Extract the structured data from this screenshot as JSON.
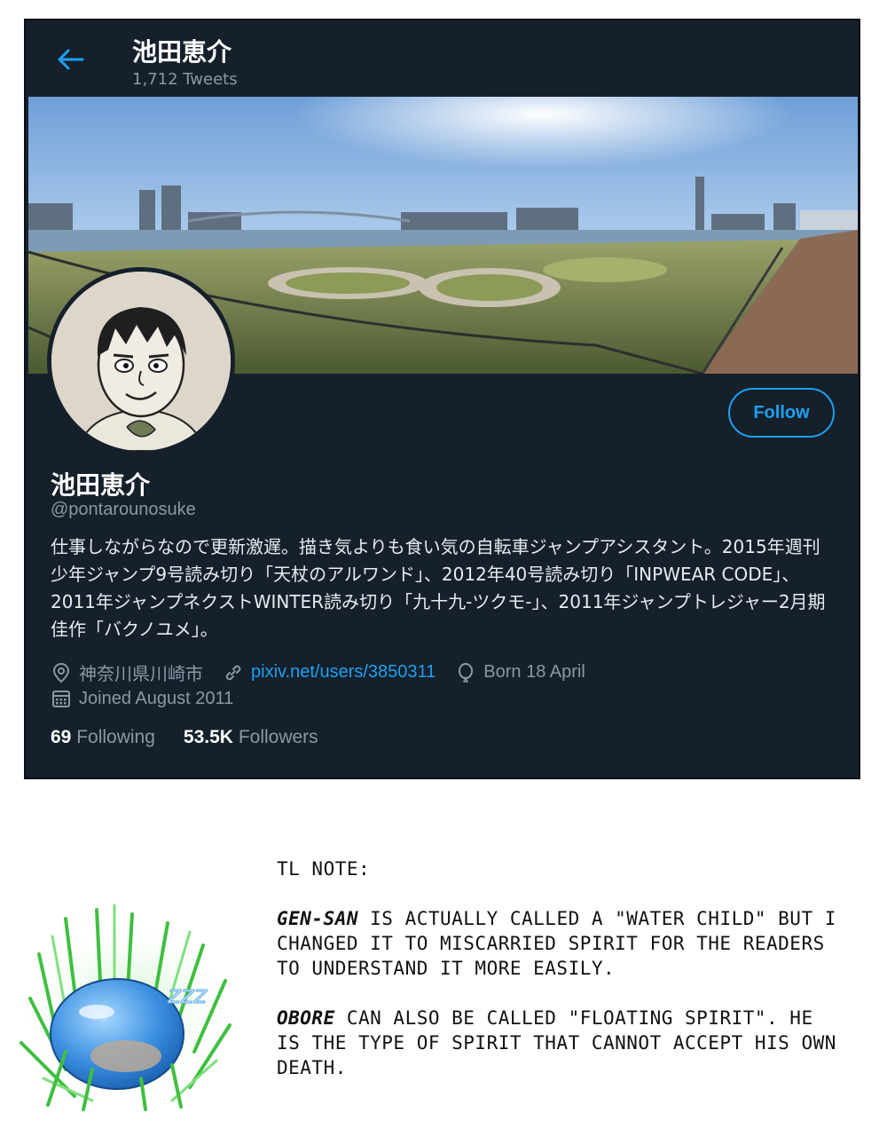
{
  "profile": {
    "header_name": "池田恵介",
    "tweet_count": "1,712 Tweets",
    "display_name": "池田恵介",
    "handle": "@pontarounosuke",
    "bio": "仕事しながらなので更新激遅。描き気よりも食い気の自転車ジャンプアシスタント。2015年週刊少年ジャンプ9号読み切り「天杖のアルワンド」、2012年40号読み切り「INPWEAR CODE」、2011年ジャンプネクストWINTER読み切り「九十九-ツクモ-」、2011年ジャンプトレジャー2月期 佳作「バクノユメ」。",
    "location": "神奈川県川崎市",
    "website": "pixiv.net/users/3850311",
    "birthday": "Born 18 April",
    "joined": "Joined August 2011",
    "following_count": "69",
    "following_label": "Following",
    "followers_count": "53.5K",
    "followers_label": "Followers",
    "follow_button": "Follow"
  },
  "icons": {
    "back": "arrow-left-icon",
    "location": "location-pin-icon",
    "website": "link-icon",
    "birthday": "balloon-icon",
    "joined": "calendar-icon"
  },
  "colors": {
    "background": "#15202b",
    "accent": "#1da1f2",
    "muted": "#8899a6"
  },
  "note": {
    "heading": "TL note:",
    "p1_em": "Gen-san",
    "p1_rest": " is actually called a \"water child\" but I changed it to miscarried spirit for the readers to understand it more easily.",
    "p2_em": "Obore",
    "p2_rest": " can also be called \"floating spirit\". He is the type of spirit that cannot accept his own death."
  },
  "illustration": {
    "zzz": "zzz"
  }
}
